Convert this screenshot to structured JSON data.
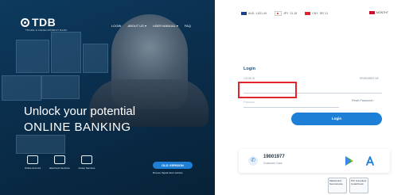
{
  "brand": {
    "name": "TDB",
    "tagline": "TRADE & DEVELOPMENT BANK"
  },
  "nav": {
    "items": [
      "LOGIN",
      "ABOUT US",
      "USER MANUAL",
      "FAQ"
    ]
  },
  "hero": {
    "headline_line1": "Unlock your potential",
    "headline_line2": "ONLINE BANKING",
    "quick_links": [
      "Online Account",
      "Electronic Services",
      "Group Services"
    ],
    "old_version": {
      "button": "OLD VERSION",
      "desc": "Browse Digital bank website"
    }
  },
  "rates": [
    {
      "code": "AUD",
      "value": "1,821.40",
      "flag_color": "#1d3f8f"
    },
    {
      "code": "JPY",
      "value": "21.18",
      "flag_color": "#e0262c"
    },
    {
      "code": "CNY",
      "value": "357.11",
      "flag_color": "#e0262c"
    }
  ],
  "language": {
    "label": "MONTHT",
    "flag_color": "#c8102e"
  },
  "login": {
    "title": "Login",
    "username_label": "LOGIN ID",
    "username_hint": "REMEMBER ME",
    "password_label": "Password",
    "forgot": "Reset Password",
    "button": "Login"
  },
  "care": {
    "number": "19001977",
    "label": "Customer Care",
    "icons": [
      "phone-icon",
      "google-play-icon",
      "app-store-icon"
    ]
  },
  "badges": [
    {
      "name": "mastercard-secure-badge",
      "text": "Mastercard SecureCode"
    },
    {
      "name": "pci-badge",
      "text": "PCI Compliant CodeCheck"
    }
  ],
  "colors": {
    "accent": "#1e7fd6",
    "hero_bg": "#0a2e4c",
    "highlight": "#e0262c"
  }
}
